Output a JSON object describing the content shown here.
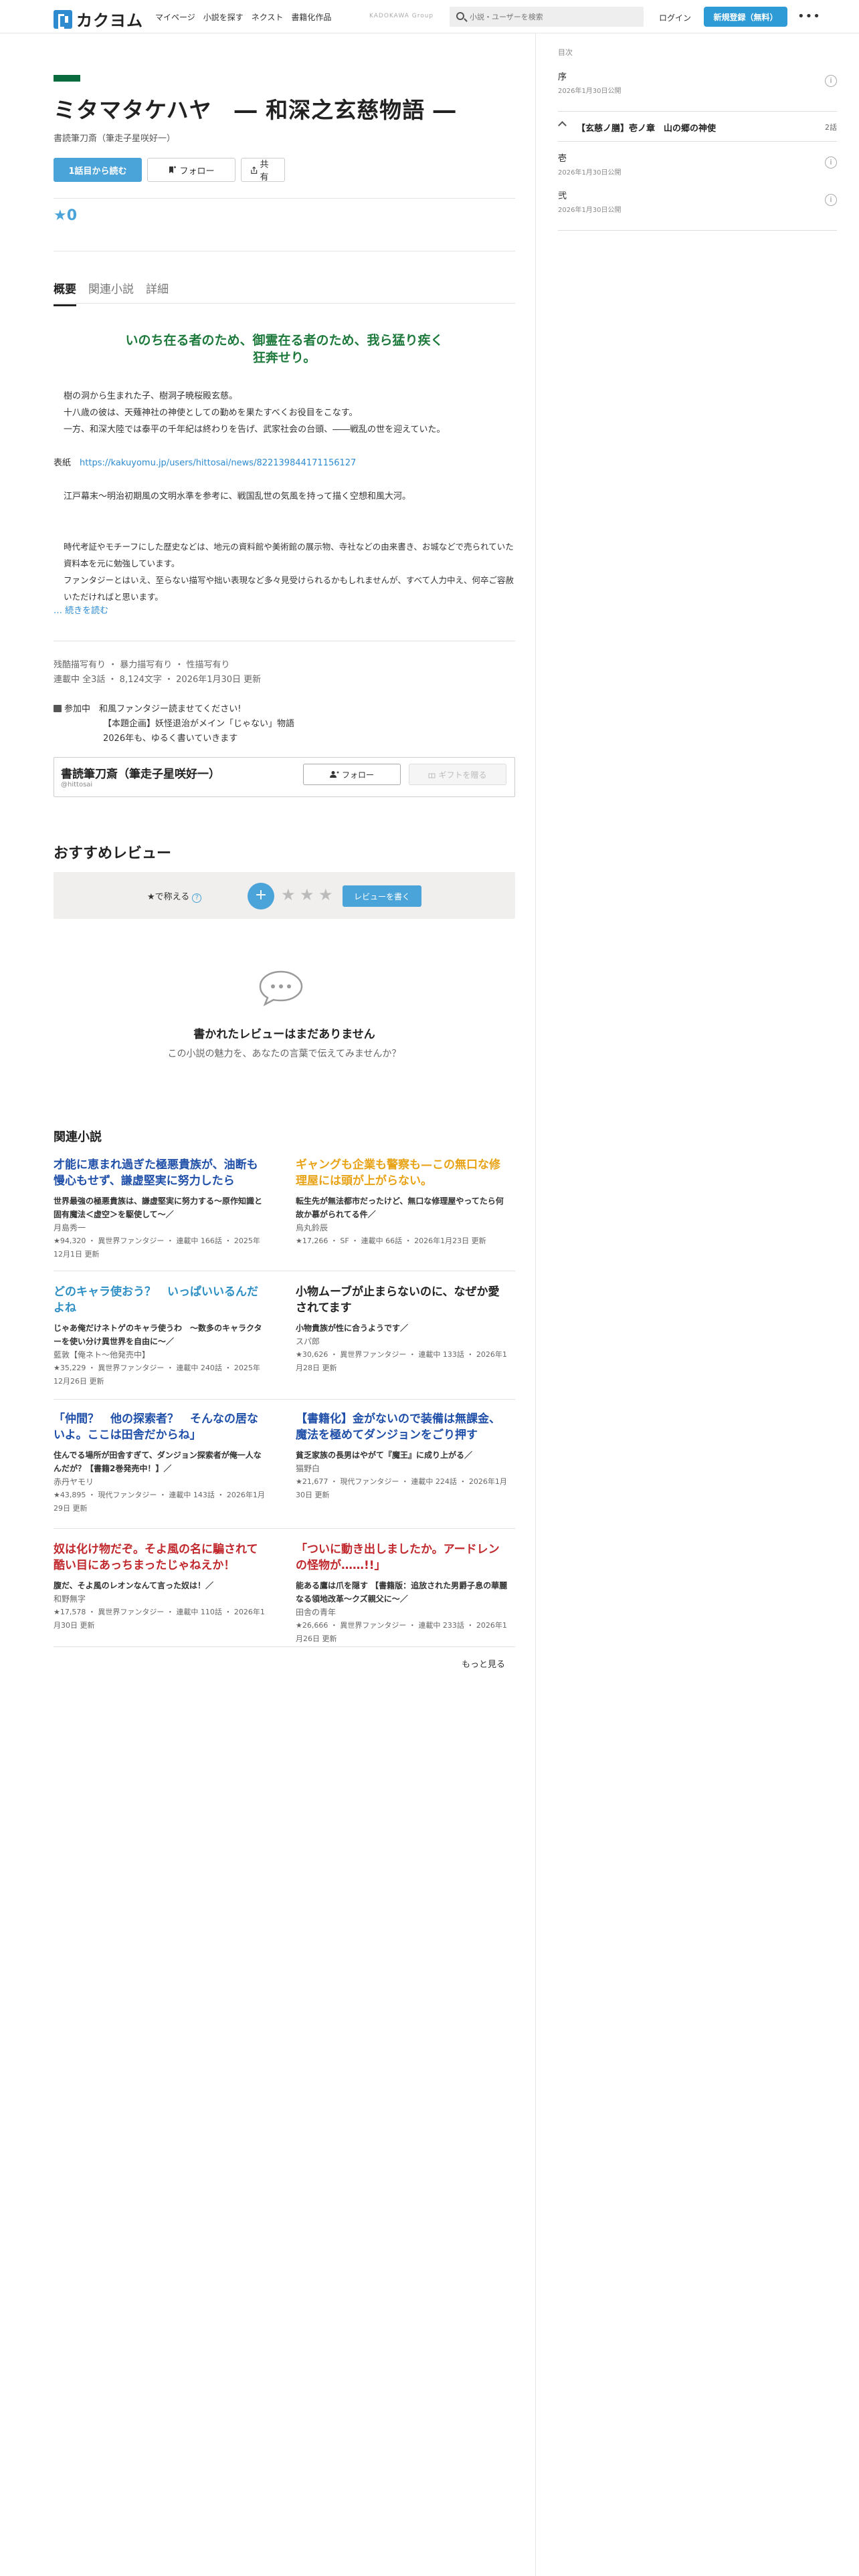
{
  "header": {
    "logo_text": "カクヨム",
    "nav": [
      "マイページ",
      "小説を探す",
      "ネクスト",
      "書籍化作品"
    ],
    "kadokawa": "KADOKAWA Group",
    "search_placeholder": "小説・ユーザーを検索",
    "login": "ログイン",
    "signup": "新規登録（無料）",
    "more": "•••"
  },
  "work": {
    "title": "ミタマタケハヤ　― 和深之玄慈物語 ―",
    "author": "書読筆刀斎（筆走子星咲好一）",
    "read_first": "1話目から読む",
    "follow": "フォロー",
    "share": "共有",
    "stars": "★0"
  },
  "tabs": [
    "概要",
    "関連小説",
    "詳細"
  ],
  "catchphrase": "いのち在る者のため、御霊在る者のため、我ら猛り疾く狂奔せり。",
  "intro": {
    "lines1": [
      "樹の洞から生まれた子、樹洞子暁桜殿玄慈。",
      "十八歳の彼は、天薙神社の神使としての勤めを果たすべくお役目をこなす。",
      "一方、和深大陸では泰平の千年紀は終わりを告げ、武家社会の台頭、――戦乱の世を迎えていた。"
    ],
    "cover_label": "表紙",
    "cover_link": "https://kakuyomu.jp/users/hittosai/news/822139844171156127",
    "lines2": [
      "江戸幕末〜明治初期風の文明水準を参考に、戦国乱世の気風を持って描く空想和風大河。"
    ],
    "lines3": [
      "時代考証やモチーフにした歴史などは、地元の資料館や美術館の展示物、寺社などの由来書き、お城などで売られていた資料本を元に勉強しています。",
      "ファンタジーとはいえ、至らない描写や拙い表現など多々見受けられるかもしれませんが、すべて人力中え、何卒ご容赦いただければと思います。"
    ],
    "read_more": "… 続きを読む"
  },
  "tags": "残酷描写有り ・ 暴力描写有り ・ 性描写有り",
  "status": "連載中 全3話 ・ 8,124文字 ・ 2026年1月30日 更新",
  "contest": {
    "label": "参加中",
    "lines": [
      "和風ファンタジー読ませてください!",
      "【本題企画】妖怪退治がメイン「じゃない」物語",
      "2026年も、ゆるく書いていきます"
    ]
  },
  "author_box": {
    "name": "書読筆刀斎（筆走子星咲好一）",
    "id": "@hittosai",
    "follow": "フォロー",
    "gift": "ギフトを贈る"
  },
  "reviews": {
    "heading": "おすすめレビュー",
    "rate_label": "★で称える",
    "help": "?",
    "plus": "+",
    "star_glyph": "★",
    "write": "レビューを書く",
    "empty_title": "書かれたレビューはまだありません",
    "empty_sub": "この小説の魅力を、あなたの言葉で伝えてみませんか？"
  },
  "related": {
    "heading": "関連小説",
    "more": "もっと見る",
    "items": [
      {
        "title": "才能に恵まれ過ぎた極悪貴族が、油断も慢心もせず、謙虚堅実に努力したら",
        "color": "#1f4fa8",
        "desc": "世界最強の極悪貴族は、謙虚堅実に努力する〜原作知識と固有魔法＜虚空＞を駆使して〜／",
        "author": "月島秀一",
        "meta": "★94,320 ・ 異世界ファンタジー ・ 連載中 166話 ・ 2025年12月1日 更新"
      },
      {
        "title": "ギャングも企業も警察も—この無口な修理屋には頭が上がらない。",
        "color": "#e8a317",
        "desc": "転生先が無法都市だったけど、無口な修理屋やってたら何故か慕がられてる件／",
        "author": "烏丸鈴辰",
        "meta": "★17,266 ・ SF ・ 連載中 66話 ・ 2026年1月23日 更新"
      },
      {
        "title": "どのキャラ使おう？　いっぱいいるんだよね",
        "color": "#2d8fc4",
        "desc": "じゃあ俺だけネトゲのキャラ使うわ　〜数多のキャラクターを使い分け異世界を自由に〜／",
        "author": "藍敦【俺ネト〜他発売中】",
        "meta": "★35,229 ・ 異世界ファンタジー ・ 連載中 240話 ・ 2025年12月26日 更新"
      },
      {
        "title": "小物ムーブが止まらないのに、なぜか愛されてます",
        "color": "#222222",
        "desc": "小物貴族が性に合うようです／",
        "author": "スパ郎",
        "meta": "★30,626 ・ 異世界ファンタジー ・ 連載中 133話 ・ 2026年1月28日 更新"
      },
      {
        "title": "「仲間？　他の探索者？　そんなの居ないよ。ここは田舎だからね」",
        "color": "#1f4fa8",
        "desc": "住んでる場所が田舎すぎて、ダンジョン探索者が俺一人なんだが？【書籍2巻発売中！】／",
        "author": "赤丹ヤモリ",
        "meta": "★43,895 ・ 現代ファンタジー ・ 連載中 143話 ・ 2026年1月29日 更新"
      },
      {
        "title": "【書籍化】金がないので装備は無課金、魔法を極めてダンジョンをごり押す",
        "color": "#1f4fa8",
        "desc": "貧乏家族の長男はやがて『魔王』に成り上がる／",
        "author": "猫野白",
        "meta": "★21,677 ・ 現代ファンタジー ・ 連載中 224話 ・ 2026年1月30日 更新"
      },
      {
        "title": "奴は化け物だぞ。そよ風の名に騙されて酷い目にあっちまったじゃねえか！",
        "color": "#c0282d",
        "desc": "腹だ、そよ風のレオンなんて言った奴は！／",
        "author": "和野無字",
        "meta": "★17,578 ・ 異世界ファンタジー ・ 連載中 110話 ・ 2026年1月30日 更新"
      },
      {
        "title": "「ついに動き出しましたか。アードレンの怪物が……!!」",
        "color": "#c0282d",
        "desc": "能ある鷹は爪を隠す 【書籍版：追放された男爵子息の華麗なる領地改革〜クズ親父に〜／",
        "author": "田舎の青年",
        "meta": "★26,666 ・ 異世界ファンタジー ・ 連載中 233話 ・ 2026年1月26日 更新"
      }
    ]
  },
  "sidebar": {
    "label": "目次",
    "ep1": {
      "title": "序",
      "date": "2026年1月30日公開"
    },
    "chapter": {
      "name": "【玄慈ノ膳】壱ノ章　山の郷の神使",
      "count": "2話"
    },
    "ep2": {
      "title": "壱",
      "date": "2026年1月30日公開"
    },
    "ep3": {
      "title": "弐",
      "date": "2026年1月30日公開"
    },
    "info_glyph": "i"
  }
}
